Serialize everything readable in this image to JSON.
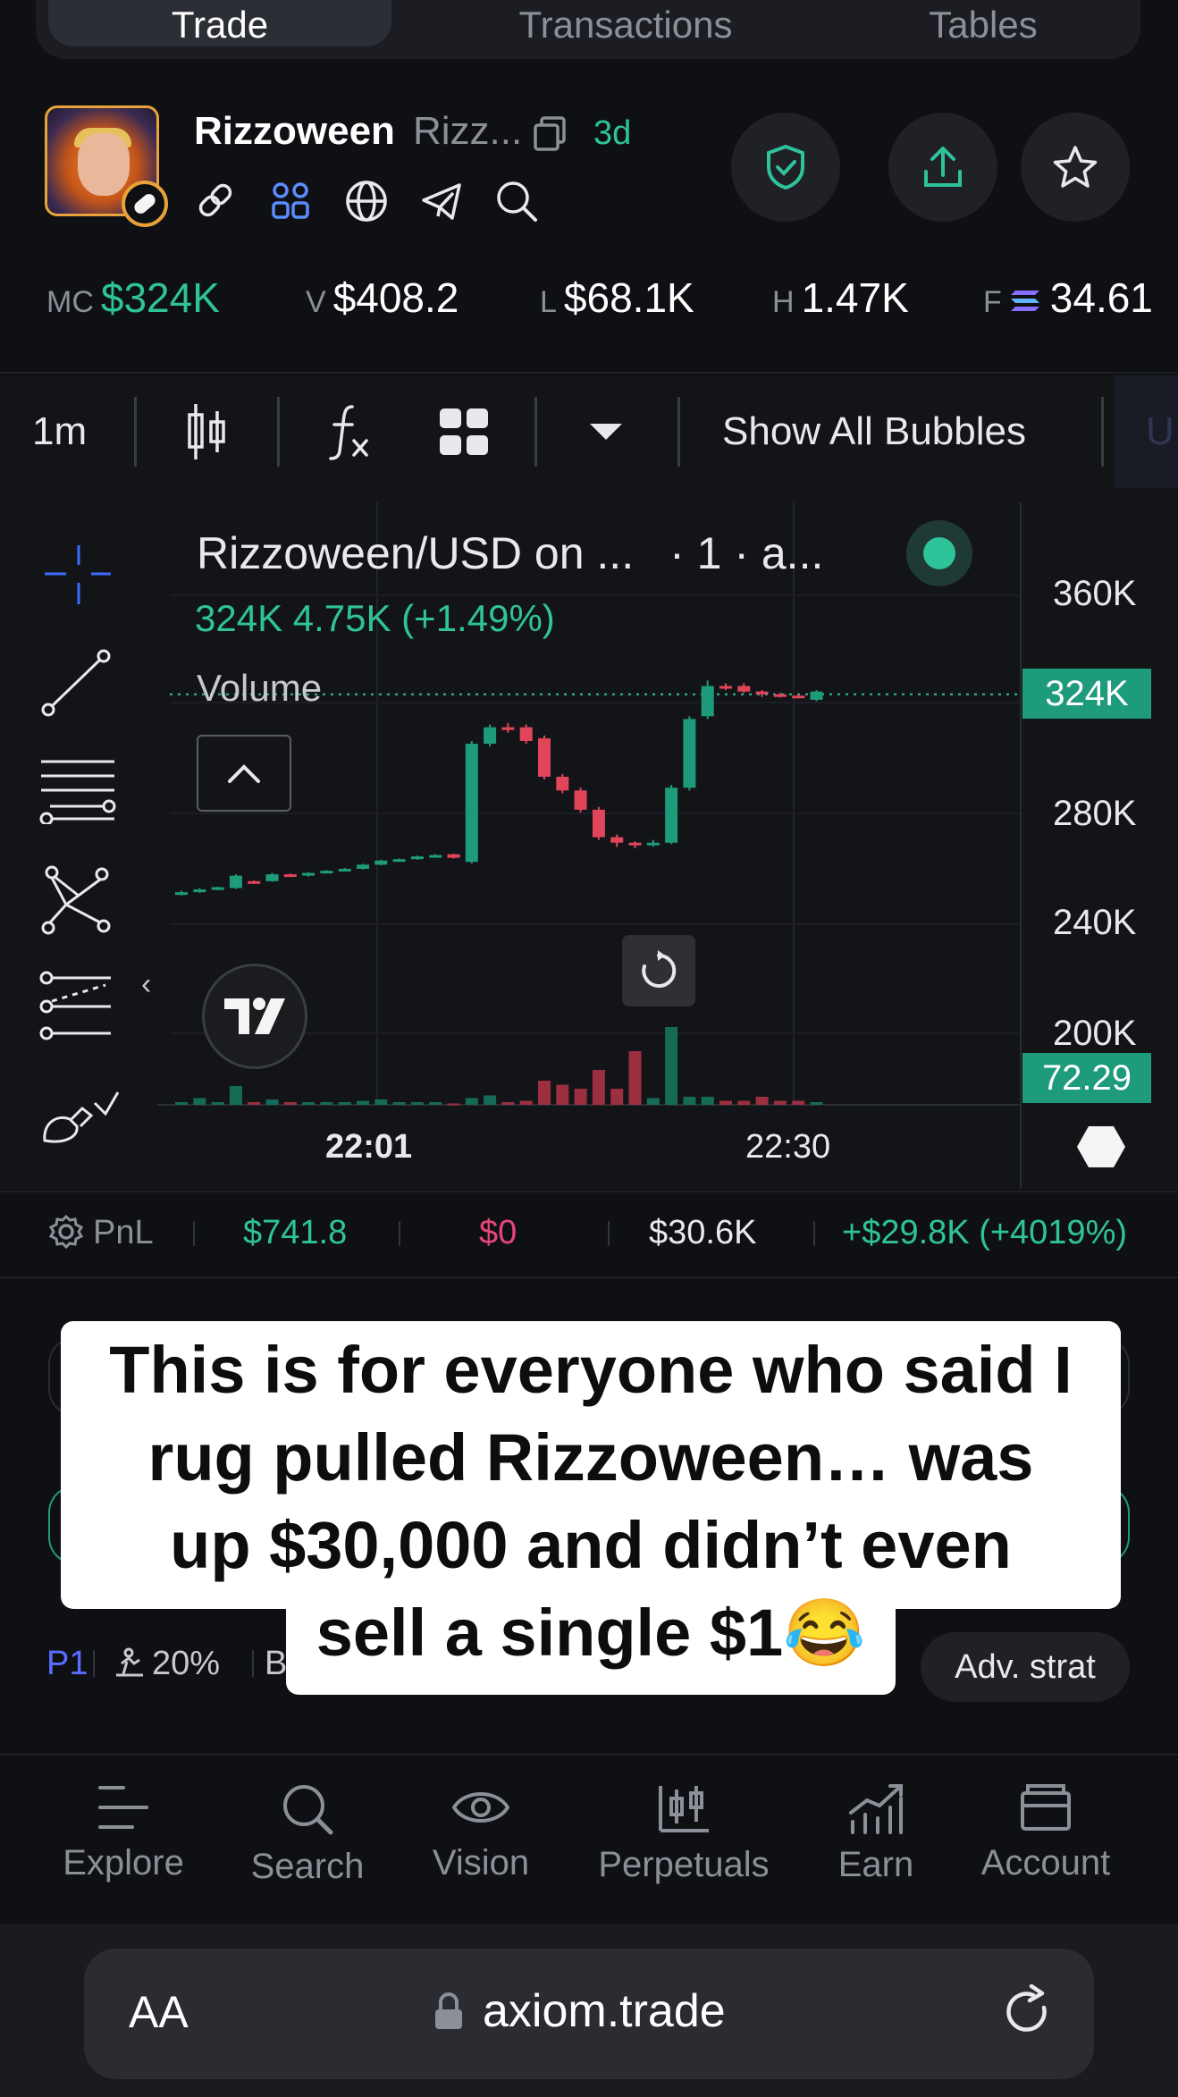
{
  "top_tabs": [
    "Trade",
    "Transactions",
    "Tables"
  ],
  "token": {
    "name": "Rizzoween",
    "symbol": "Rizz...",
    "age": "3d"
  },
  "stats": [
    {
      "key": "MC",
      "value": "$324K",
      "color": "#2fc39a"
    },
    {
      "key": "V",
      "value": "$408.2"
    },
    {
      "key": "L",
      "value": "$68.1K"
    },
    {
      "key": "H",
      "value": "1.47K"
    },
    {
      "key": "F",
      "value": "34.61"
    }
  ],
  "toolbar": {
    "interval": "1m",
    "bubbles": "Show All Bubbles",
    "cut_off": "U"
  },
  "chart": {
    "title": "Rizzoween/USD on ...",
    "title_suffix": "· 1 · a...",
    "ohlc": "324K  4.75K (+1.49%)",
    "volume_label": "Volume",
    "price_axis": [
      "360K",
      "324K",
      "280K",
      "240K",
      "200K"
    ],
    "current_price": "324K",
    "volume_tag": "72.29",
    "time_axis": [
      "22:01",
      "22:30"
    ]
  },
  "chart_data": {
    "type": "candlestick",
    "x_ticks": [
      "22:01",
      "22:30"
    ],
    "y_ticks": [
      "200K",
      "240K",
      "280K",
      "320K",
      "360K"
    ],
    "ylim": [
      190000,
      375000
    ],
    "last_price": 324000,
    "candles": [
      {
        "o": 251000,
        "c": 252000,
        "h": 252500,
        "l": 250800,
        "up": true
      },
      {
        "o": 252000,
        "c": 253000,
        "h": 253500,
        "l": 251800,
        "up": true
      },
      {
        "o": 253000,
        "c": 253800,
        "h": 254000,
        "l": 252700,
        "up": true
      },
      {
        "o": 253500,
        "c": 258000,
        "h": 258500,
        "l": 253200,
        "up": true
      },
      {
        "o": 256000,
        "c": 255500,
        "h": 256300,
        "l": 255000,
        "up": false
      },
      {
        "o": 256000,
        "c": 258500,
        "h": 259000,
        "l": 255800,
        "up": true
      },
      {
        "o": 258500,
        "c": 258000,
        "h": 258800,
        "l": 257800,
        "up": false
      },
      {
        "o": 258000,
        "c": 259000,
        "h": 259300,
        "l": 257700,
        "up": true
      },
      {
        "o": 259000,
        "c": 259800,
        "h": 260000,
        "l": 258800,
        "up": true
      },
      {
        "o": 260000,
        "c": 260500,
        "h": 260800,
        "l": 259800,
        "up": true
      },
      {
        "o": 260500,
        "c": 262000,
        "h": 262300,
        "l": 260300,
        "up": true
      },
      {
        "o": 262000,
        "c": 263500,
        "h": 263800,
        "l": 261800,
        "up": true
      },
      {
        "o": 263500,
        "c": 264000,
        "h": 264300,
        "l": 263200,
        "up": true
      },
      {
        "o": 264000,
        "c": 265000,
        "h": 265300,
        "l": 263800,
        "up": true
      },
      {
        "o": 265000,
        "c": 265500,
        "h": 265800,
        "l": 264800,
        "up": true
      },
      {
        "o": 265800,
        "c": 264500,
        "h": 266000,
        "l": 264200,
        "up": false
      },
      {
        "o": 263000,
        "c": 306000,
        "h": 307000,
        "l": 262500,
        "up": true
      },
      {
        "o": 306000,
        "c": 312000,
        "h": 313000,
        "l": 305000,
        "up": true
      },
      {
        "o": 312000,
        "c": 311000,
        "h": 313500,
        "l": 310000,
        "up": false
      },
      {
        "o": 312000,
        "c": 307000,
        "h": 313000,
        "l": 306000,
        "up": false
      },
      {
        "o": 308000,
        "c": 294000,
        "h": 309000,
        "l": 293000,
        "up": false
      },
      {
        "o": 294000,
        "c": 289000,
        "h": 295000,
        "l": 288000,
        "up": false
      },
      {
        "o": 289000,
        "c": 282000,
        "h": 290000,
        "l": 281000,
        "up": false
      },
      {
        "o": 282000,
        "c": 272000,
        "h": 283000,
        "l": 271000,
        "up": false
      },
      {
        "o": 272000,
        "c": 270000,
        "h": 273000,
        "l": 268500,
        "up": false
      },
      {
        "o": 270000,
        "c": 269500,
        "h": 270500,
        "l": 268000,
        "up": false
      },
      {
        "o": 269500,
        "c": 270000,
        "h": 271000,
        "l": 268500,
        "up": true
      },
      {
        "o": 270000,
        "c": 290000,
        "h": 291000,
        "l": 269500,
        "up": true
      },
      {
        "o": 290000,
        "c": 315000,
        "h": 316000,
        "l": 289000,
        "up": true
      },
      {
        "o": 316000,
        "c": 327000,
        "h": 329000,
        "l": 315000,
        "up": true
      },
      {
        "o": 327000,
        "c": 326500,
        "h": 328000,
        "l": 325500,
        "up": false
      },
      {
        "o": 327000,
        "c": 325000,
        "h": 328000,
        "l": 324500,
        "up": false
      },
      {
        "o": 325000,
        "c": 324000,
        "h": 325500,
        "l": 323000,
        "up": false
      },
      {
        "o": 324000,
        "c": 323500,
        "h": 324500,
        "l": 322800,
        "up": false
      },
      {
        "o": 323500,
        "c": 323000,
        "h": 324000,
        "l": 322500,
        "up": false
      },
      {
        "o": 322000,
        "c": 325000,
        "h": 325500,
        "l": 321500,
        "up": true
      }
    ],
    "volumes": [
      2,
      5,
      2,
      14,
      2,
      4,
      2,
      2,
      2,
      2,
      3,
      4,
      2,
      2,
      2,
      1,
      5,
      7,
      2,
      3,
      18,
      15,
      12,
      26,
      12,
      40,
      5,
      58,
      6,
      6,
      3,
      3,
      6,
      3,
      3,
      2
    ],
    "volume_max": 60
  },
  "pnl": {
    "label": "PnL",
    "invested": "$741.8",
    "sold": "$0",
    "holding": "$30.6K",
    "pnl": "+$29.8K (+4019%)"
  },
  "caption": {
    "line1": "This is for everyone who said I",
    "line2": "rug pulled Rizzoween… was",
    "line3": "up $30,000 and didn’t even",
    "line4": "sell a single $1😂"
  },
  "trade_footer": {
    "preset": "P1",
    "slippage": "20%",
    "adv_strat": "Adv. strat"
  },
  "bottom_nav": [
    "Explore",
    "Search",
    "Vision",
    "Perpetuals",
    "Earn",
    "Account"
  ],
  "browser": {
    "text_size": "AA",
    "url": "axiom.trade"
  },
  "colors": {
    "green": "#2fc39a",
    "red": "#e0455a",
    "pink": "#e8457a",
    "accent_blue": "#5b6cff",
    "background": "#0f1014"
  }
}
